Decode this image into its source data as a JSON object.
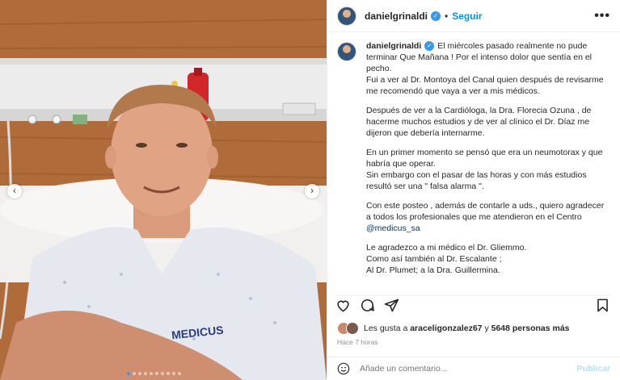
{
  "post": {
    "username": "danielgrinaldi",
    "follow_label": "Seguir",
    "dot": "•",
    "more_label": "•••"
  },
  "photo": {
    "gown_text": "MEDICUS",
    "nav_prev": "‹",
    "nav_next": "›",
    "carousel_count": 10,
    "carousel_active_index": 0
  },
  "caption": {
    "username": "danielgrinaldi",
    "p1": "El miércoles pasado realmente no pude terminar Que Mañana ! Por el intenso dolor que sentía en el pecho.\nFui a ver al Dr. Montoya del Canal quien después de revisarme me recomendó que vaya a ver a mis médicos.",
    "p2": "Después de ver a la Cardióloga, la Dra. Florecia Ozuna , de hacerme muchos estudios y de ver al clínico el Dr. Díaz me dijeron que debería internarme.",
    "p3": "En un primer momento se pensó que era un neumotorax y que habría que operar.\nSin embargo con el pasar de las horas y con más estudios resultó ser una \" falsa alarma \".",
    "p4": "Con este posteo , además de contarle a uds., quiero agradecer a todos los profesionales que me atendieron en el Centro",
    "mention": "@medicus_sa",
    "p5": "Le agradezco a mi médico el Dr. Gliemmo.\nComo así también al Dr. Escalante ;\nAl Dr. Plumet; a la Dra. Guillermina."
  },
  "likes": {
    "prefix": "Les gusta a",
    "user": "araceligonzalez67",
    "middle": "y",
    "count": "5648 personas más"
  },
  "time": "Hace 7 horas",
  "comment": {
    "placeholder": "Añade un comentario...",
    "publish_label": "Publicar"
  },
  "colors": {
    "accent": "#0095f6",
    "verified": "#3897f0",
    "publish_disabled": "#b2dffc"
  }
}
